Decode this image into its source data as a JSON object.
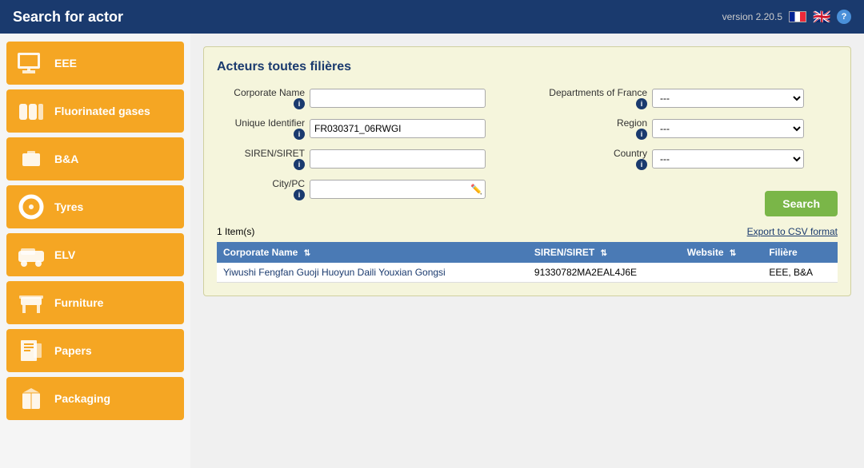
{
  "header": {
    "title": "Search for actor",
    "version": "version 2.20.5"
  },
  "sidebar": {
    "items": [
      {
        "id": "eee",
        "label": "EEE",
        "icon": "🖨️"
      },
      {
        "id": "fluorinated-gases",
        "label": "Fluorinated gases",
        "icon": "🔵"
      },
      {
        "id": "ba",
        "label": "B&A",
        "icon": "🔋"
      },
      {
        "id": "tyres",
        "label": "Tyres",
        "icon": "⚫"
      },
      {
        "id": "elv",
        "label": "ELV",
        "icon": "🚗"
      },
      {
        "id": "furniture",
        "label": "Furniture",
        "icon": "🪑"
      },
      {
        "id": "papers",
        "label": "Papers",
        "icon": "📄"
      },
      {
        "id": "packaging",
        "label": "Packaging",
        "icon": "📦"
      }
    ]
  },
  "panel": {
    "title": "Acteurs toutes filières",
    "form": {
      "corporate_name_label": "Corporate Name",
      "unique_identifier_label": "Unique Identifier",
      "siren_siret_label": "SIREN/SIRET",
      "city_pc_label": "City/PC",
      "departments_label": "Departments of France",
      "region_label": "Region",
      "country_label": "Country",
      "corporate_name_value": "",
      "unique_identifier_value": "FR030371_06RWGI",
      "siren_siret_value": "",
      "city_pc_value": "",
      "departments_value": "---",
      "region_value": "---",
      "country_value": "---"
    },
    "search_button": "Search",
    "export_link": "Export to CSV format",
    "results_count": "1 Item(s)"
  },
  "table": {
    "headers": [
      {
        "label": "Corporate Name",
        "sortable": true
      },
      {
        "label": "SIREN/SIRET",
        "sortable": true
      },
      {
        "label": "Website",
        "sortable": true
      },
      {
        "label": "Filière",
        "sortable": false
      }
    ],
    "rows": [
      {
        "corporate_name": "Yiwushi Fengfan Guoji Huoyun Daili Youxian Gongsi",
        "siren_siret": "91330782MA2EAL4J6E",
        "website": "",
        "filiere": "EEE, B&A"
      }
    ]
  }
}
